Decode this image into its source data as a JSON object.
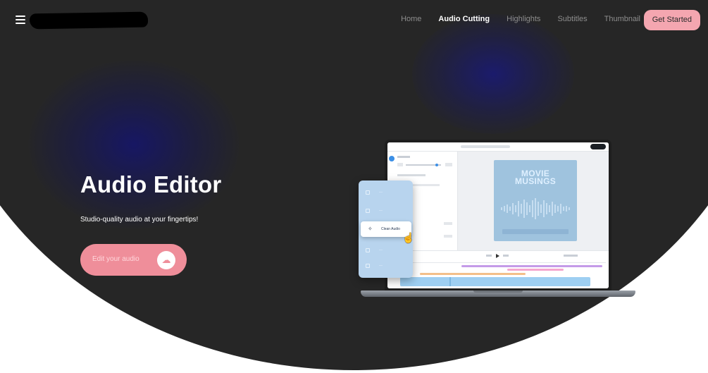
{
  "nav": {
    "links": [
      {
        "label": "Home",
        "active": false
      },
      {
        "label": "Audio Cutting",
        "active": true
      },
      {
        "label": "Highlights",
        "active": false
      },
      {
        "label": "Subtitles",
        "active": false
      },
      {
        "label": "Thumbnail",
        "active": false
      }
    ],
    "cta_label": "Get Started"
  },
  "hero": {
    "title": "Audio Editor",
    "subtitle": "Studio-quality audio at your fingertips!",
    "button_label": "Edit your audio",
    "button_icon": "cloud-upload-icon"
  },
  "mockup": {
    "poster_title_line1": "MOVIE",
    "poster_title_line2": "MUSINGS",
    "selected_menu_item": "Clean Audio"
  },
  "colors": {
    "background": "#262626",
    "accent_pink": "#f4a6b0",
    "button_pink": "#ef8e9a",
    "glow_blue": "#14146e",
    "menu_blue": "#b8d4ee",
    "poster_blue": "#9fc3de"
  }
}
